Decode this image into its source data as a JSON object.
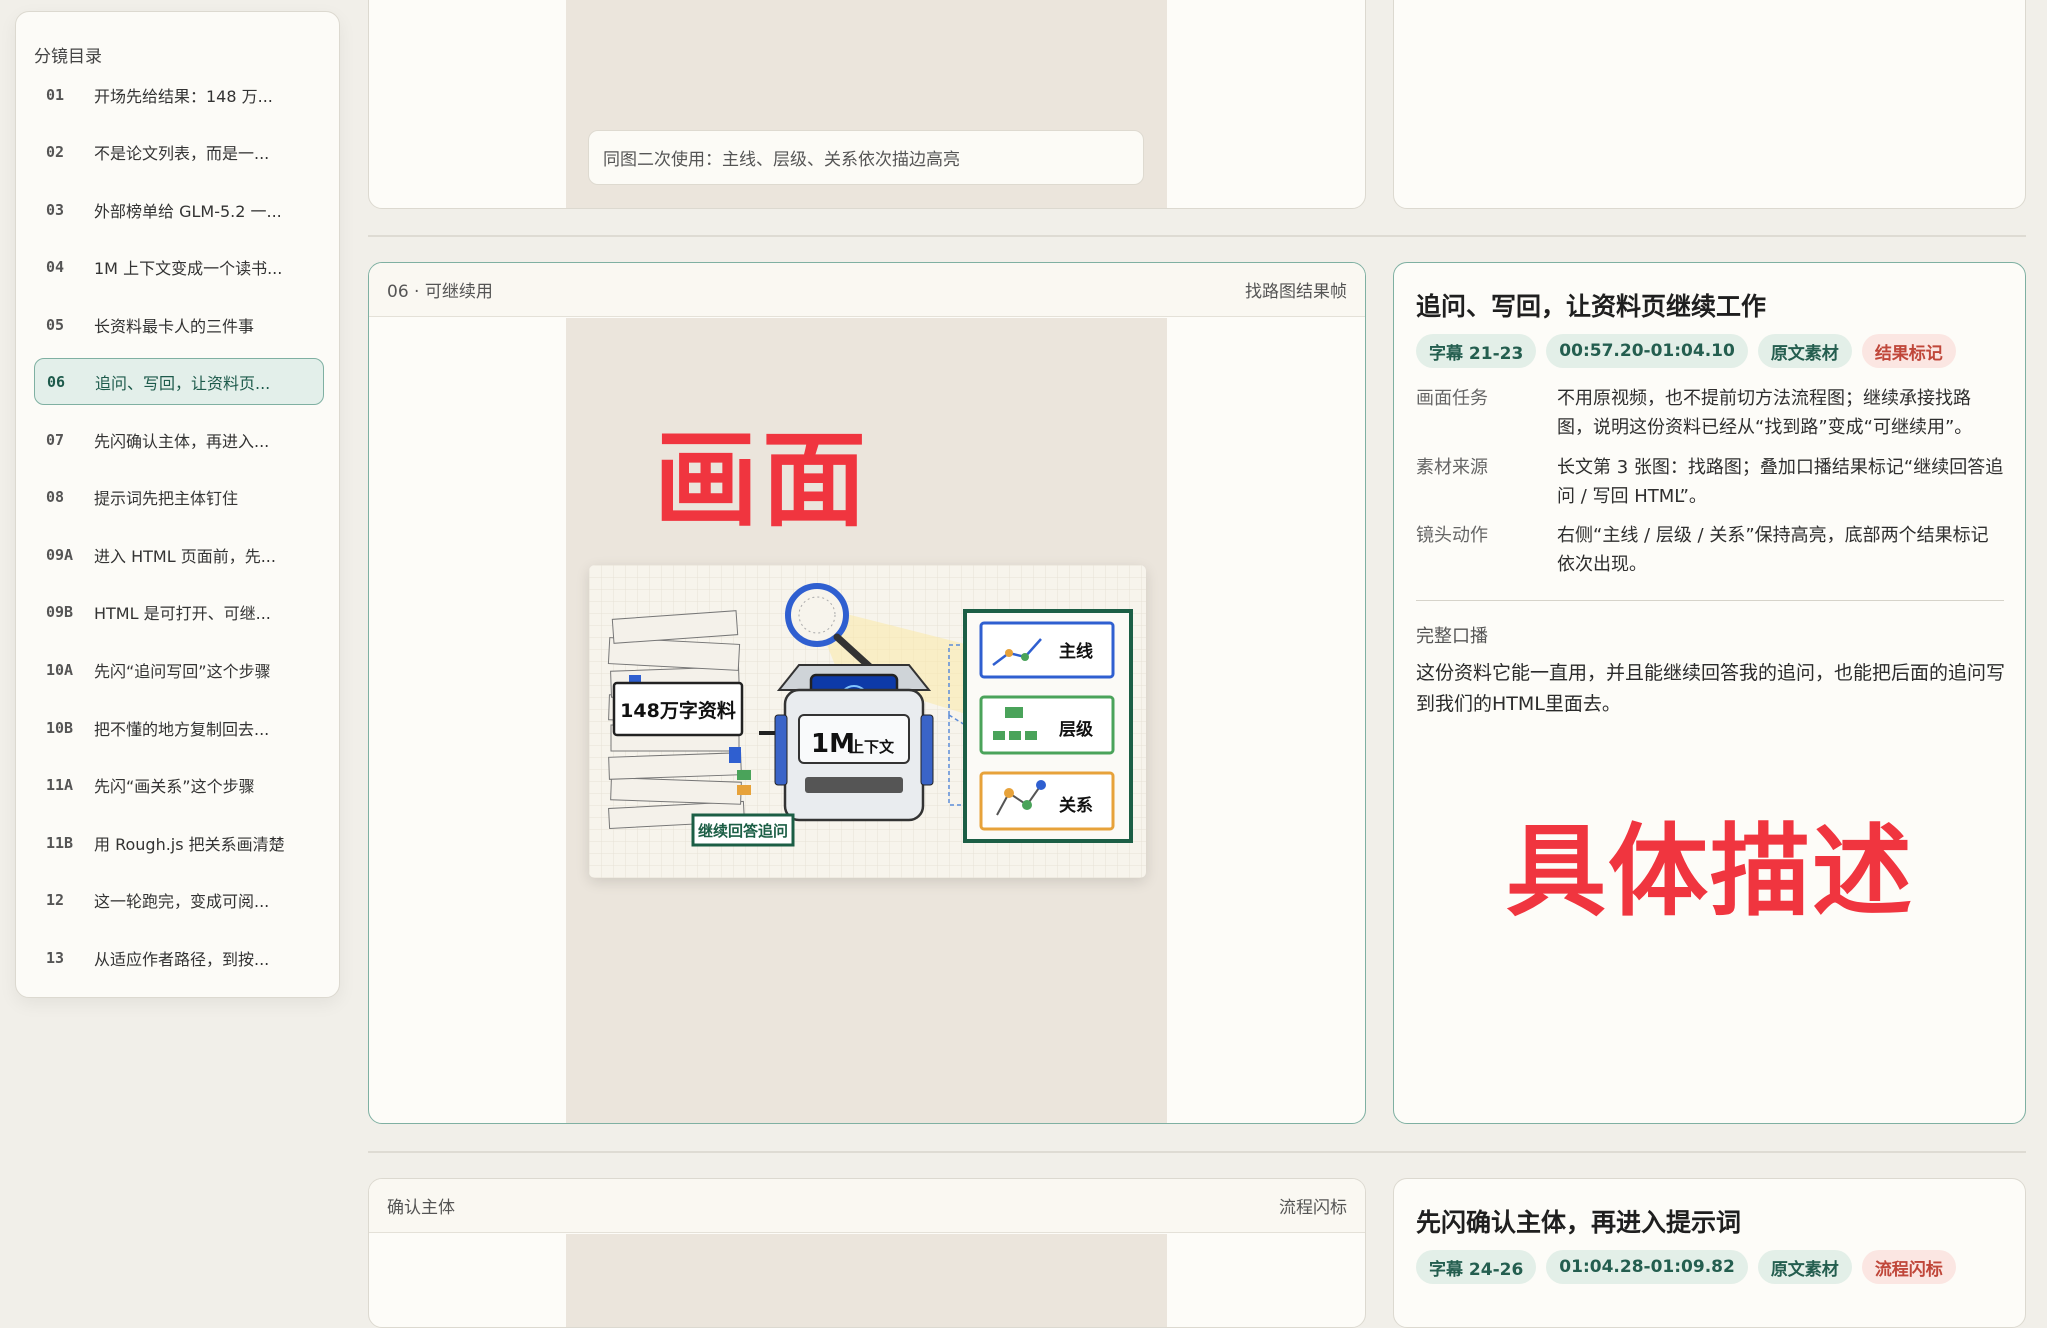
{
  "sidebar": {
    "title": "分镜目录",
    "items": [
      {
        "num": "01",
        "label": "开场先给结果：148 万..."
      },
      {
        "num": "02",
        "label": "不是论文列表，而是一..."
      },
      {
        "num": "03",
        "label": "外部榜单给 GLM-5.2 一..."
      },
      {
        "num": "04",
        "label": "1M 上下文变成一个读书..."
      },
      {
        "num": "05",
        "label": "长资料最卡人的三件事"
      },
      {
        "num": "06",
        "label": "追问、写回，让资料页..."
      },
      {
        "num": "07",
        "label": "先闪确认主体，再进入..."
      },
      {
        "num": "08",
        "label": "提示词先把主体钉住"
      },
      {
        "num": "09A",
        "label": "进入 HTML 页面前，先..."
      },
      {
        "num": "09B",
        "label": "HTML 是可打开、可继..."
      },
      {
        "num": "10A",
        "label": "先闪“追问写回”这个步骤"
      },
      {
        "num": "10B",
        "label": "把不懂的地方复制回去..."
      },
      {
        "num": "11A",
        "label": "先闪“画关系”这个步骤"
      },
      {
        "num": "11B",
        "label": "用 Rough.js 把关系画清楚"
      },
      {
        "num": "12",
        "label": "这一轮跑完，变成可阅..."
      },
      {
        "num": "13",
        "label": "从适应作者路径，到按..."
      }
    ]
  },
  "prev_shot": {
    "hint": "同图二次使用：主线、层级、关系依次描边高亮"
  },
  "shot06": {
    "head_left": "06 · 可继续用",
    "head_right": "找路图结果帧",
    "overlay_text": "画面",
    "illustration": {
      "stack_label": "148万字资料",
      "robot_label_big": "1M",
      "robot_label_small": "上下文",
      "bottom_label": "继续回答追问",
      "panels": [
        "主线",
        "层级",
        "关系"
      ]
    },
    "detail": {
      "title": "追问、写回，让资料页继续工作",
      "tags": [
        {
          "text": "字幕 21-23",
          "tone": "g"
        },
        {
          "text": "00:57.20-01:04.10",
          "tone": "g"
        },
        {
          "text": "原文素材",
          "tone": "g"
        },
        {
          "text": "结果标记",
          "tone": "r"
        }
      ],
      "rows": [
        {
          "k": "画面任务",
          "v": "不用原视频，也不提前切方法流程图；继续承接找路图，说明这份资料已经从“找到路”变成“可继续用”。"
        },
        {
          "k": "素材来源",
          "v": "长文第 3 张图：找路图；叠加口播结果标记“继续回答追问 / 写回 HTML”。"
        },
        {
          "k": "镜头动作",
          "v": "右侧“主线 / 层级 / 关系”保持高亮，底部两个结果标记依次出现。"
        }
      ],
      "full_label": "完整口播",
      "full_text": "这份资料它能一直用，并且能继续回答我的追问，也能把后面的追问写到我们的HTML里面去。",
      "overlay_text": "具体描述"
    }
  },
  "shot07": {
    "head_left": "确认主体",
    "head_right": "流程闪标",
    "title": "先闪确认主体，再进入提示词",
    "tags": [
      {
        "text": "字幕 24-26",
        "tone": "g"
      },
      {
        "text": "01:04.28-01:09.82",
        "tone": "g"
      },
      {
        "text": "原文素材",
        "tone": "g"
      },
      {
        "text": "流程闪标",
        "tone": "r"
      }
    ]
  },
  "colors": {
    "accent": "#245e4f",
    "red_tag": "#c0473a",
    "overlay_red": "#f0353f"
  }
}
